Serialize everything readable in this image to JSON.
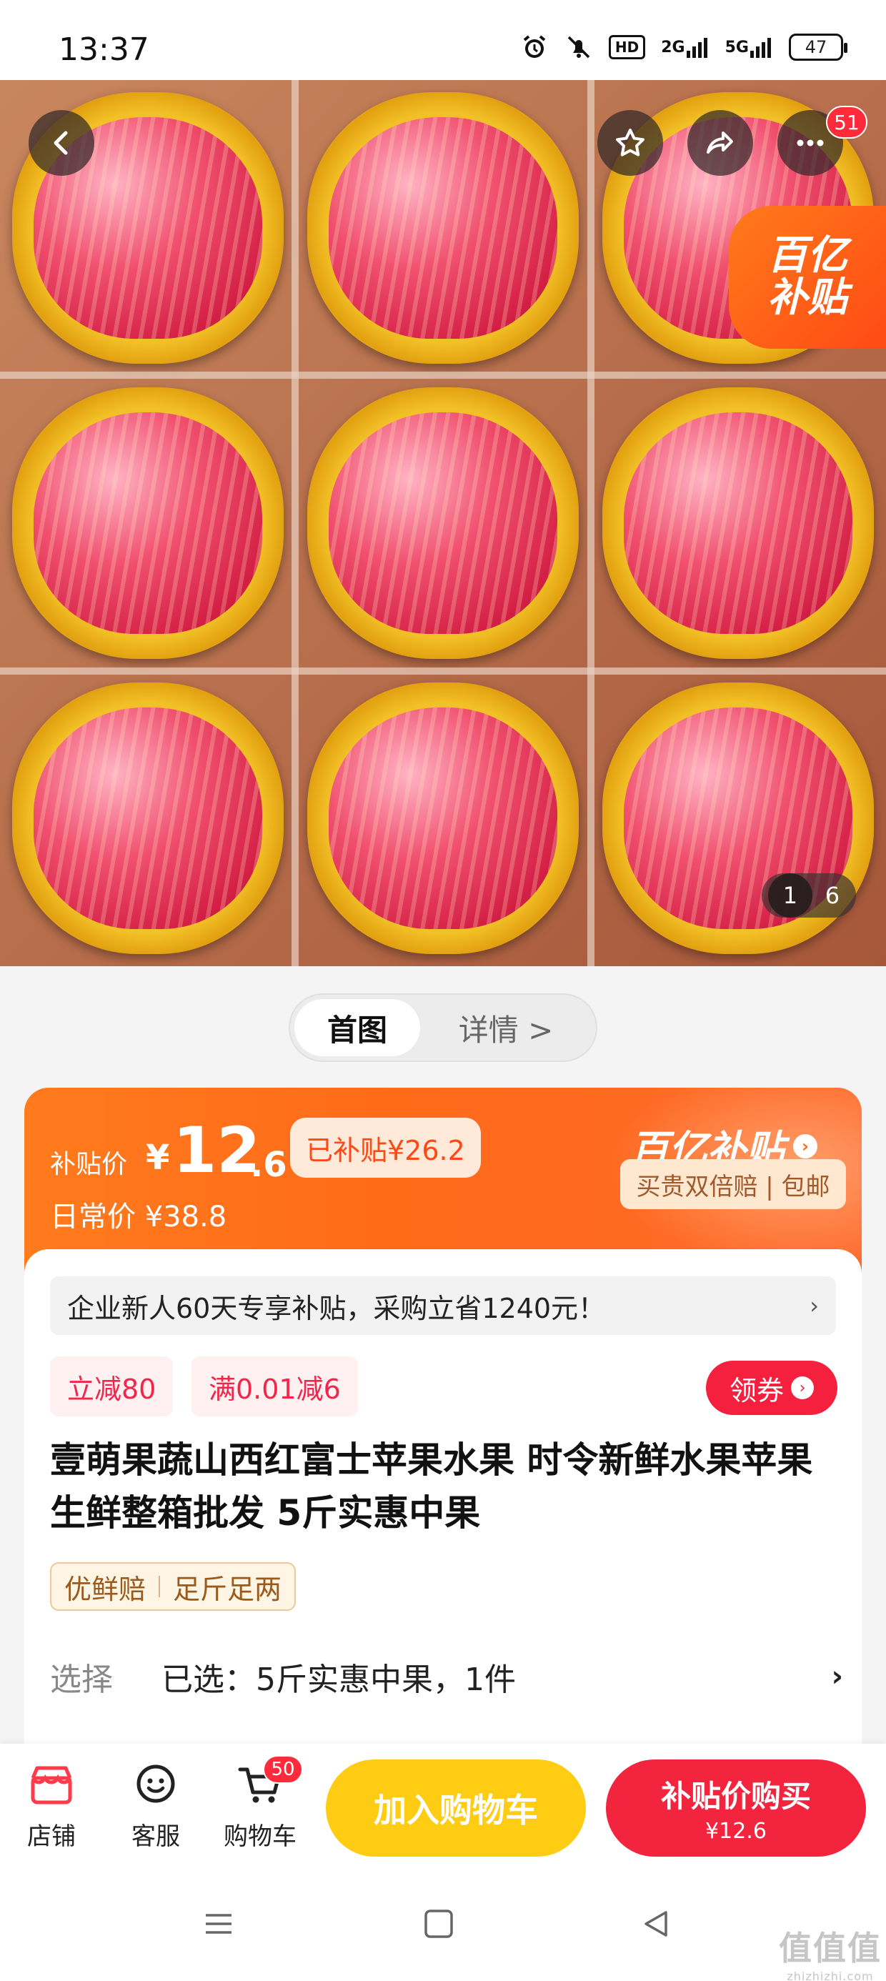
{
  "status_bar": {
    "time": "13:37",
    "network_1": "2G",
    "network_2": "5G",
    "hd_label": "HD",
    "battery": "47"
  },
  "hero": {
    "notification_count": "51",
    "subsidy_sticker_line1": "百亿",
    "subsidy_sticker_line2": "补贴",
    "page_current": "1",
    "page_total": "6"
  },
  "image_tabs": {
    "main": "首图",
    "detail": "详情 >"
  },
  "price": {
    "label": "补贴价",
    "currency": "¥",
    "integer": "12",
    "decimal": ".6",
    "subsidy_badge": "已补贴¥26.2",
    "daily_price": "日常价 ¥38.8",
    "brand": "百亿补贴",
    "guarantee": "买贵双倍赔 | 包邮"
  },
  "promo": {
    "text": "企业新人60天专享补贴，采购立省1240元！",
    "chevron": "›"
  },
  "coupons": {
    "tag1": "立减80",
    "tag2": "满0.01减6",
    "claim_button": "领券"
  },
  "product": {
    "title": "壹萌果蔬山西红富士苹果水果 时令新鲜水果苹果生鲜整箱批发 5斤实惠中果",
    "tag1": "优鲜赔",
    "tag2": "足斤足两"
  },
  "selection": {
    "label": "选择",
    "value": "已选：5斤实惠中果，1件",
    "chevron": "›"
  },
  "bottom_bar": {
    "shop": "店铺",
    "service": "客服",
    "cart": "购物车",
    "cart_count": "50",
    "add_to_cart": "加入购物车",
    "buy_label": "补贴价购买",
    "buy_price": "¥12.6"
  },
  "watermark": {
    "main": "值值值",
    "sub": "zhizhizhi.com"
  },
  "colors": {
    "orange": "#ff6a19",
    "red": "#f2243e",
    "yellow": "#ffcc14"
  }
}
